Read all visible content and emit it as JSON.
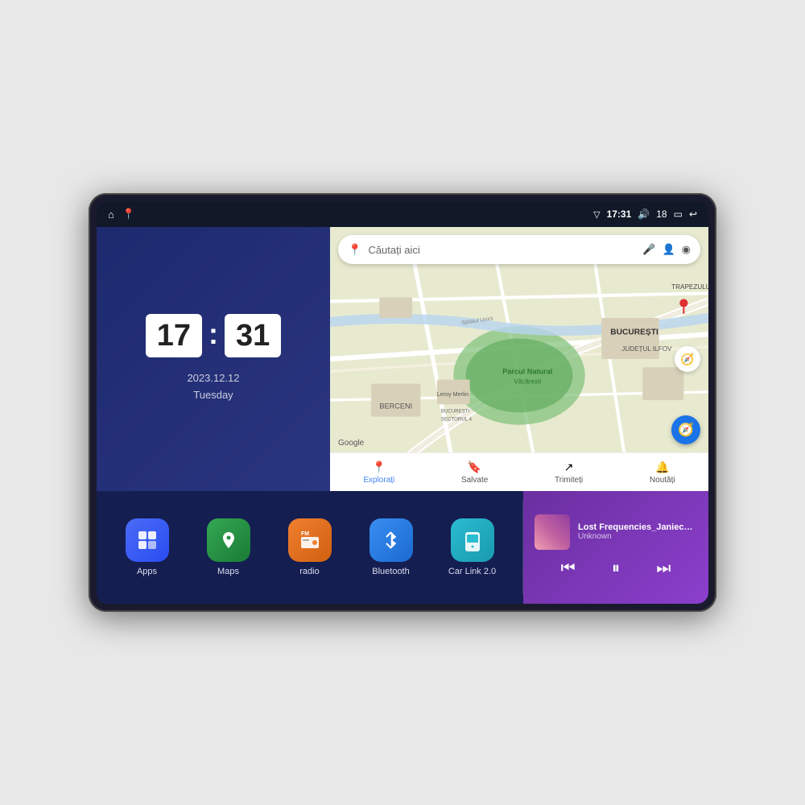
{
  "device": {
    "status_bar": {
      "signal_icon": "▽",
      "time": "17:31",
      "volume_icon": "🔊",
      "battery_level": "18",
      "battery_icon": "▭",
      "back_icon": "↩",
      "nav_home_icon": "⌂",
      "nav_maps_icon": "📍"
    },
    "clock": {
      "hour": "17",
      "minute": "31",
      "date": "2023.12.12",
      "day": "Tuesday"
    },
    "map": {
      "search_placeholder": "Căutați aici",
      "nav_items": [
        {
          "label": "Explorați",
          "icon": "📍",
          "active": true
        },
        {
          "label": "Salvate",
          "icon": "🔖",
          "active": false
        },
        {
          "label": "Trimiteți",
          "icon": "↗",
          "active": false
        },
        {
          "label": "Noutăți",
          "icon": "🔔",
          "active": false
        }
      ],
      "labels": {
        "trapezului": "TRAPEZULUI",
        "bucuresti": "BUCUREȘTI",
        "judetul_ilfov": "JUDEȚUL ILFOV",
        "berceni": "BERCENI",
        "parcul": "Parcul Natural Văcărești",
        "leroy": "Leroy Merlin",
        "sector4": "BUCUREȘTI SECTORUL 4",
        "splaiul_unirii": "Splaiul Unirii",
        "google": "Google"
      }
    },
    "apps": [
      {
        "id": "apps",
        "label": "Apps",
        "icon": "⊞",
        "icon_class": "icon-apps"
      },
      {
        "id": "maps",
        "label": "Maps",
        "icon": "📍",
        "icon_class": "icon-maps"
      },
      {
        "id": "radio",
        "label": "radio",
        "icon": "📻",
        "icon_class": "icon-radio"
      },
      {
        "id": "bluetooth",
        "label": "Bluetooth",
        "icon": "⚡",
        "icon_class": "icon-bluetooth"
      },
      {
        "id": "carlink",
        "label": "Car Link 2.0",
        "icon": "📱",
        "icon_class": "icon-carlink"
      }
    ],
    "music": {
      "title": "Lost Frequencies_Janieck Devy-...",
      "artist": "Unknown",
      "prev_icon": "⏮",
      "play_icon": "⏸",
      "next_icon": "⏭"
    }
  }
}
